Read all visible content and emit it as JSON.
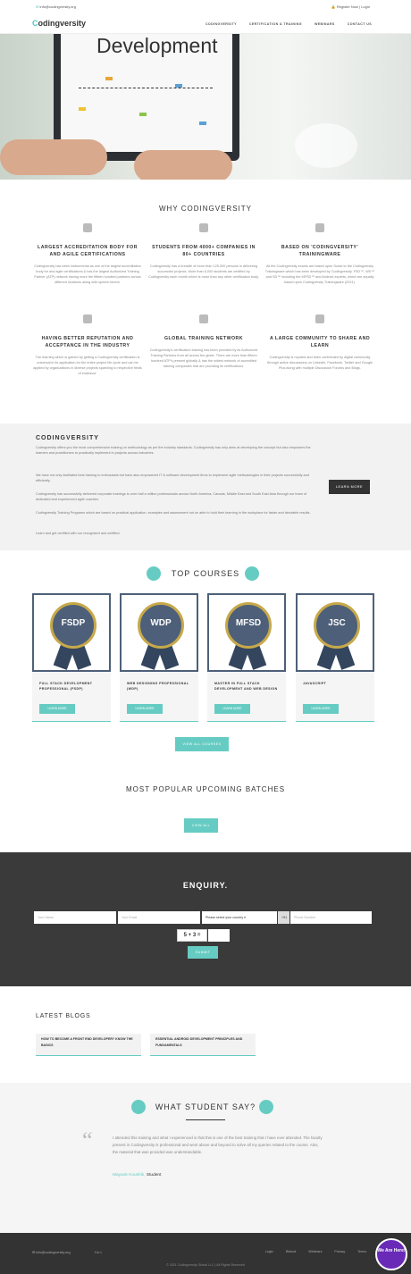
{
  "topbar": {
    "email": "info@codingversity.org",
    "register": "Register Now",
    "login": "Login"
  },
  "nav": {
    "logo_prefix": "C",
    "logo_text": "odingversity",
    "links": [
      "CODINGVERSITY",
      "CERTIFICATION & TRAINING",
      "WEBINARS",
      "CONTACT US"
    ]
  },
  "hero": {
    "title": "Development"
  },
  "why": {
    "title": "WHY CODINGVERSITY",
    "items": [
      {
        "title": "LARGEST ACCREDITATION BODY FOR AND AGILE CERTIFICATIONS",
        "text": "Codingversity has been instrumental as one of the largest accreditation body for and agile certifications & has the largest Authorized Training Partner (ATP) network having more the fifteen hundred partners across different locations along with speech timers."
      },
      {
        "title": "STUDENTS FROM 4000+ COMPANIES IN 80+ COUNTRIES",
        "text": "Codingversity has a breadth of more than 125,000 persons in delivering successful projects. More than 6,000 students are certified by Codingversity each month which is more than any other certification body."
      },
      {
        "title": "BASED ON 'CODINGVERSITY' TRAININGWARE",
        "text": "All the Codingversity exams are based upon Guide to the Codingversity Trainingware which has been developed by Codingversity. FSD™, WD™ and SD™ including the MFSD™ and Android experts, which are equally based upon Codingversity Trainingware (2021)."
      },
      {
        "title": "HAVING BETTER REPUTATION AND ACCEPTANCE IN THE INDUSTRY",
        "text": "The learning which is gained by getting a Codingversity certification is universal in its application for the entire project life cycle and can be applied by organizations in diverse projects spanning to respective fields of endeavor."
      },
      {
        "title": "GLOBAL TRAINING NETWORK",
        "text": "Codingversity's certification training has been provided by its Authorized Training Partners from all across the globe. There are more than fifteen hundred ATP's present globally & has the widest network of accredited training companies that are providing its certifications."
      },
      {
        "title": "A LARGE COMMUNITY TO SHARE AND LEARN",
        "text": "Codingversity is reputed and been contributed by digital community through active discussions on LinkedIn, Facebook, Twitter and Google Plus along with multiple Discussion Forums and Blogs."
      }
    ]
  },
  "about": {
    "title": "CODINGVERSITY",
    "p1": "Codingversity offers you the most comprehensive training on methodology as per the industry standards. Codingversity has only aims at developing the concept but also empowers the learners and practitioners to practically implement in projects across industries.",
    "p2": "We have not only facilitated best training to enthusiasts but have also empowered IT & software development firms to implement agile methodologies in their projects successfully and efficiently.",
    "p3": "Codingversity has successfully delivered corporate trainings to over half a million professionals across North America, Canada, Middle East and South East Asia through our team of dedicated and experienced agile coaches.",
    "p4": "Codingversity Training Programs which are based on practical application, examples and assessment not on able to hold their learning in the workplace for faster and desirable results.",
    "p5": "Learn and get certified with our recognized and certified.",
    "button": "LEARN MORE"
  },
  "courses": {
    "title": "TOP COURSES",
    "items": [
      {
        "badge": "FSDP",
        "name": "FULL STACK DEVELOPMENT PROFESSIONAL (FSDP)",
        "button": "LEARN MORE"
      },
      {
        "badge": "WDP",
        "name": "WEB DESIGNING PROFESSIONAL (WDP)",
        "button": "LEARN MORE"
      },
      {
        "badge": "MFSD",
        "name": "MASTER IN FULL STACK DEVELOPMENT AND WEB DESIGN",
        "button": "LEARN MORE"
      },
      {
        "badge": "JSC",
        "name": "JAVASCRIPT",
        "button": "LEARN MORE"
      }
    ],
    "view_all": "VIEW ALL COURSES"
  },
  "batches": {
    "title": "MOST POPULAR UPCOMING BATCHES",
    "button": "VIEW ALL"
  },
  "enquiry": {
    "title": "ENQUIRY.",
    "name_ph": "Your Name",
    "email_ph": "Your Email",
    "country": "Please select your country",
    "code": "+91",
    "phone_ph": "Phone Number",
    "captcha": "5 + 3 =",
    "submit": "SUBMIT"
  },
  "blogs": {
    "title": "LATEST BLOGS",
    "items": [
      "HOW TO BECOME A FRONT END DEVELOPER? KNOW THE BASICS",
      "ESSENTIAL ANDROID DEVELOPMENT PRINCIPLES AND FUNDAMENTALS"
    ]
  },
  "testimonial": {
    "title": "WHAT STUDENT SAY?",
    "quote": "I attended this training and what I experienced is that this is one of the best training that I have ever attended. The faculty present in Codingversity is professional and went above and beyond to solve all my queries related to the course. Also, the material that was provided was understandable.",
    "author": "Mayank Koushik,",
    "role": "Student"
  },
  "footer": {
    "email": "info@codingversity.org",
    "links": [
      "Login",
      "Refund",
      "Webinars",
      "Privacy",
      "Terms"
    ],
    "copyright": "© 2021 Codingversity Global LLC | All Rights Reserved",
    "chat": "We Are Here!"
  },
  "colors": {
    "accent": "#66ccc3",
    "dark": "#333333",
    "navy": "#4e6079"
  }
}
